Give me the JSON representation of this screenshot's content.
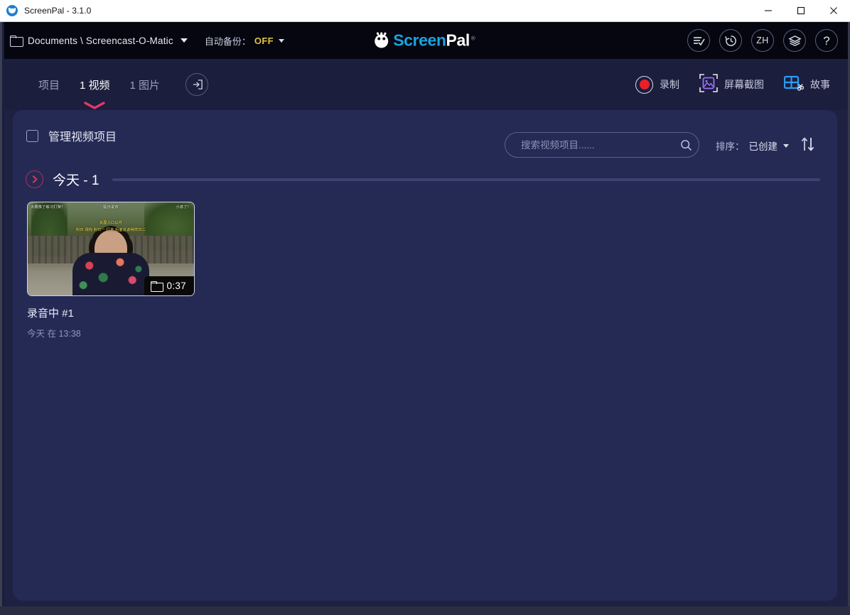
{
  "window": {
    "title": "ScreenPal - 3.1.0",
    "app_icon": "screenpal-smiley-icon",
    "minimize_label": "Minimize",
    "maximize_label": "Maximize",
    "close_label": "Close"
  },
  "toolbar": {
    "folder_icon": "folder-icon",
    "path": "Documents \\ Screencast-O-Matic",
    "backup_label": "自动备份：",
    "backup_value": "OFF",
    "brand_part1": "Screen",
    "brand_part2": "Pal",
    "brand_registered": "®",
    "icons": [
      {
        "name": "list-check-icon",
        "label": ""
      },
      {
        "name": "history-clock-icon",
        "label": ""
      },
      {
        "name": "language-icon",
        "label": "ZH"
      },
      {
        "name": "layers-icon",
        "label": ""
      },
      {
        "name": "help-icon",
        "label": "?"
      }
    ]
  },
  "tabs": [
    {
      "label": "项目",
      "active": false
    },
    {
      "label": "1 视频",
      "active": true
    },
    {
      "label": "1 图片",
      "active": false
    }
  ],
  "import_button": {
    "icon": "import-icon"
  },
  "actions": [
    {
      "icon": "record-icon",
      "label": "录制"
    },
    {
      "icon": "screenshot-icon",
      "label": "屏幕截图"
    },
    {
      "icon": "story-grid-scissors-icon",
      "label": "故事"
    }
  ],
  "panel": {
    "manage_label": "管理视频项目",
    "manage_checked": false,
    "search": {
      "placeholder": "搜索视频项目......",
      "value": "",
      "icon": "search-icon"
    },
    "sort": {
      "label": "排序：",
      "value": "已创建",
      "direction_icon": "sort-updown-icon"
    },
    "group": {
      "chevron_icon": "chevron-right-icon",
      "title": "今天 - 1"
    },
    "items": [
      {
        "title": "录音中 #1",
        "subtitle": "今天 在 13:38",
        "duration": "0:37",
        "badge_icon": "folder-icon",
        "thumb_overlay": {
          "line_a": "大概像了练习打架！",
          "line_b": "贴示说市",
          "line_c": "小孩了！",
          "line_d": "关屋人口以月",
          "line_e": "利日  领拘  利日一  打京  后面总该得样日二"
        }
      }
    ]
  },
  "colors": {
    "toolbar_bg": "#05060f",
    "page_bg": "#1b1e3c",
    "panel_bg": "#252a55",
    "accent_pink": "#e0386b",
    "brand_blue": "#1ba2e0",
    "record_red": "#e8202a",
    "backup_yellow": "#e3c53a",
    "screenshot_purple": "#9b6ef3",
    "story_blue": "#2f9bf0"
  }
}
